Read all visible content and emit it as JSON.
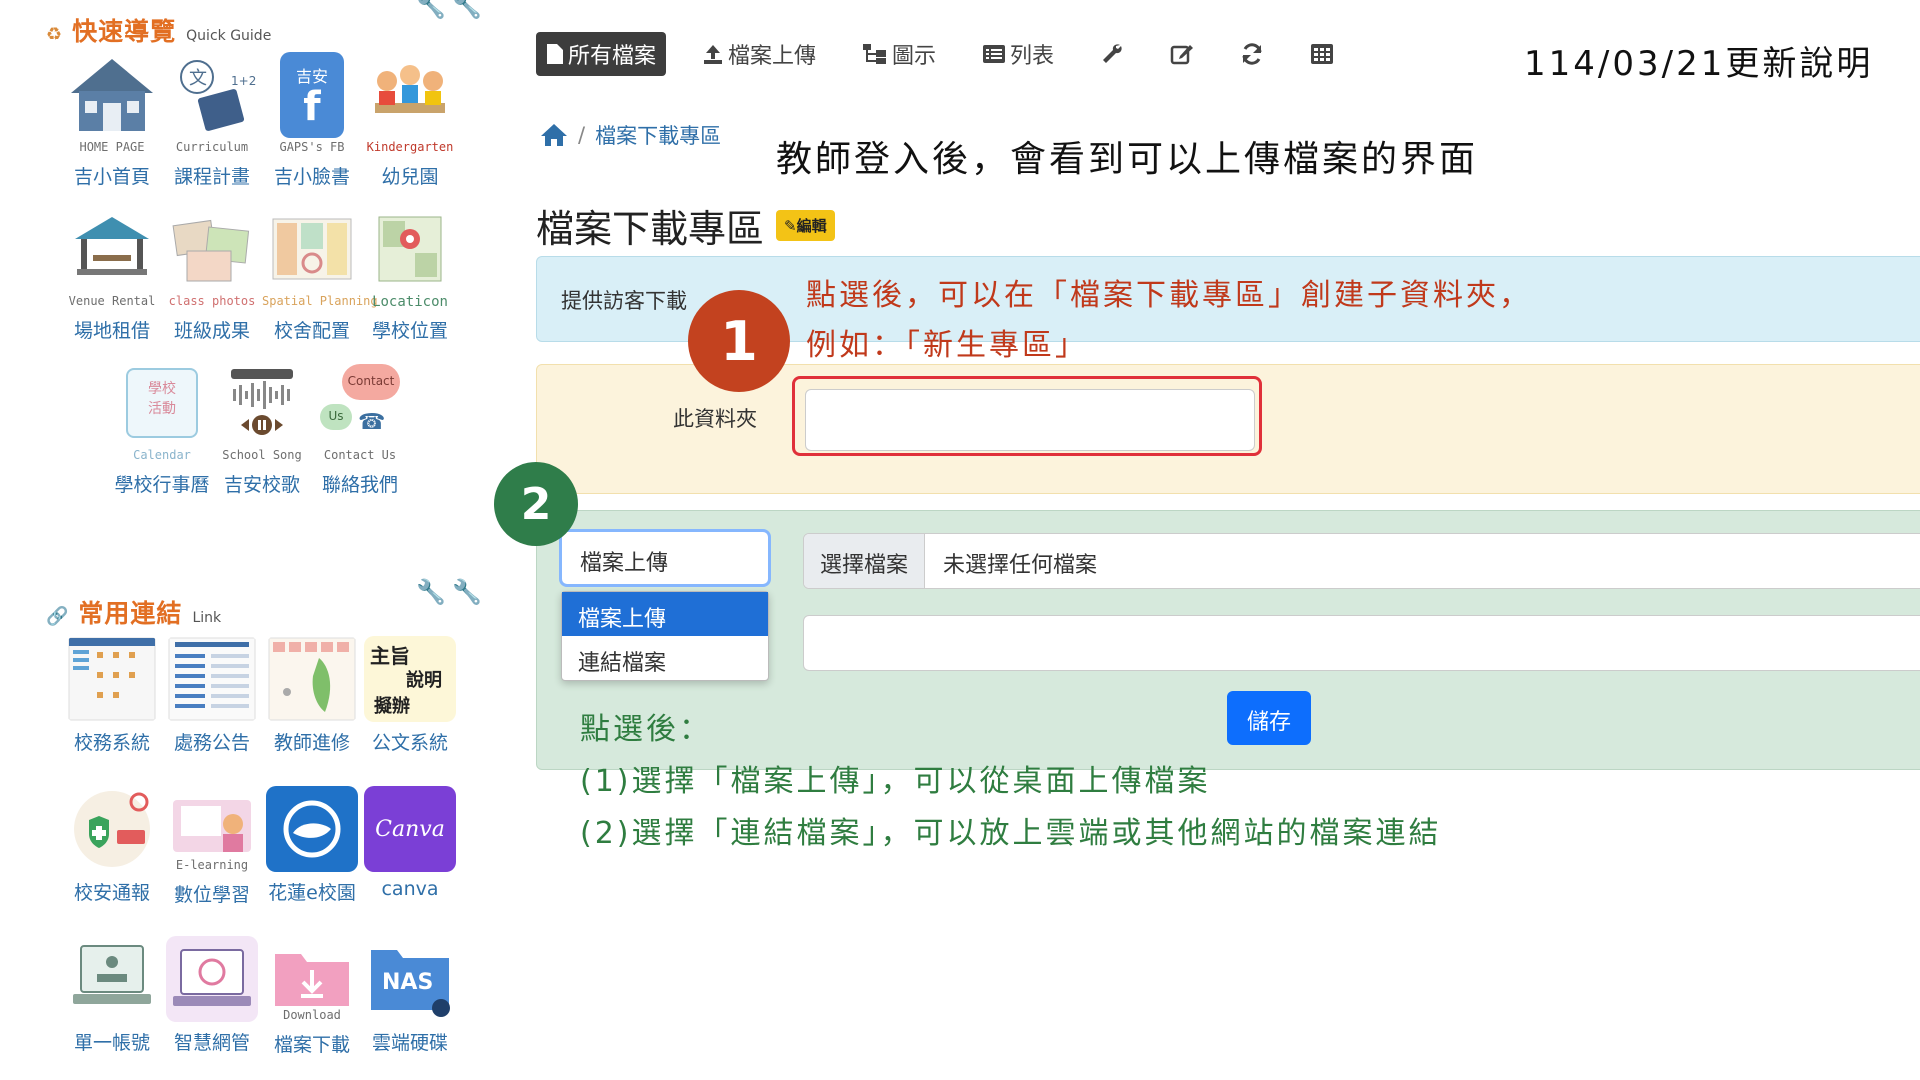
{
  "sidebar": {
    "quick_guide": {
      "title": "快速導覽",
      "subtitle": "Quick Guide",
      "tiles": [
        {
          "caption": "HOME PAGE",
          "label": "吉小首頁"
        },
        {
          "caption": "Curriculum",
          "label": "課程計畫"
        },
        {
          "caption": "GAPS's FB",
          "label": "吉小臉書"
        },
        {
          "caption": "Kindergarten",
          "label": "幼兒園"
        },
        {
          "caption": "Venue Rental",
          "label": "場地租借"
        },
        {
          "caption": "class photos",
          "label": "班級成果"
        },
        {
          "caption": "Spatial Planning",
          "label": "校舍配置"
        },
        {
          "caption": "Locaticon",
          "label": "學校位置"
        },
        {
          "caption": "Calendar",
          "label": "學校行事曆"
        },
        {
          "caption": "School Song",
          "label": "吉安校歌"
        },
        {
          "caption": "Contact Us",
          "label": "聯絡我們"
        }
      ],
      "pic_text": {
        "gaps": "吉安",
        "calendar_line1": "學校",
        "calendar_line2": "活動",
        "contact": "Contact",
        "us": "Us"
      }
    },
    "links": {
      "title": "常用連結",
      "subtitle": "Link",
      "tiles": [
        {
          "label": "校務系統"
        },
        {
          "label": "處務公告"
        },
        {
          "label": "教師進修"
        },
        {
          "label": "公文系統"
        },
        {
          "label": "校安通報"
        },
        {
          "caption": "E-learning",
          "label": "數位學習"
        },
        {
          "label": "花蓮e校園"
        },
        {
          "label": "canva"
        },
        {
          "label": "單一帳號"
        },
        {
          "label": "智慧網管"
        },
        {
          "caption": "Download",
          "label": "檔案下載"
        },
        {
          "label": "雲端硬碟"
        }
      ],
      "pic_text": {
        "doc_line1": "主旨",
        "doc_line2": "說明",
        "doc_line3": "擬辦",
        "canva": "Canva",
        "nas": "NAS"
      }
    }
  },
  "toolbar": {
    "buttons": [
      {
        "label": "所有檔案",
        "icon": "file-icon",
        "active": true
      },
      {
        "label": "檔案上傳",
        "icon": "upload-icon"
      },
      {
        "label": "圖示",
        "icon": "tree-icon"
      },
      {
        "label": "列表",
        "icon": "list-icon"
      },
      {
        "label": "",
        "icon": "wrench-icon"
      },
      {
        "label": "",
        "icon": "edit-icon"
      },
      {
        "label": "",
        "icon": "refresh-icon"
      },
      {
        "label": "",
        "icon": "table-icon"
      }
    ]
  },
  "update_note": "114/03/21更新說明",
  "breadcrumb": {
    "sep": "/",
    "current": "檔案下載專區"
  },
  "annotations": {
    "intro": "教師登入後，會看到可以上傳檔案的界面",
    "step1_line1": "點選後，可以在「檔案下載專區」創建子資料夾，",
    "step1_line2": "例如：「新生專區」",
    "step2_line1": "點選後：",
    "step2_line2": "(1)選擇「檔案上傳」，可以從桌面上傳檔案",
    "step2_line3": "(2)選擇「連結檔案」，可以放上雲端或其他網站的檔案連結"
  },
  "steps": {
    "one": "1",
    "two": "2"
  },
  "page": {
    "title": "檔案下載專區",
    "edit_badge": "✎編輯"
  },
  "form": {
    "visitor_label": "提供訪客下載",
    "folder_label": "此資料夾",
    "folder_value": "",
    "type_select": {
      "value": "檔案上傳",
      "options": [
        "檔案上傳",
        "連結檔案"
      ]
    },
    "choose_file": "選擇檔案",
    "no_file": "未選擇任何檔案",
    "link_value": "",
    "save": "儲存"
  },
  "colors": {
    "accent": "#0d6efd",
    "step1": "#c3421f",
    "step2": "#2f7d4a",
    "note_red": "#c0391b",
    "note_green": "#2f7d40"
  }
}
